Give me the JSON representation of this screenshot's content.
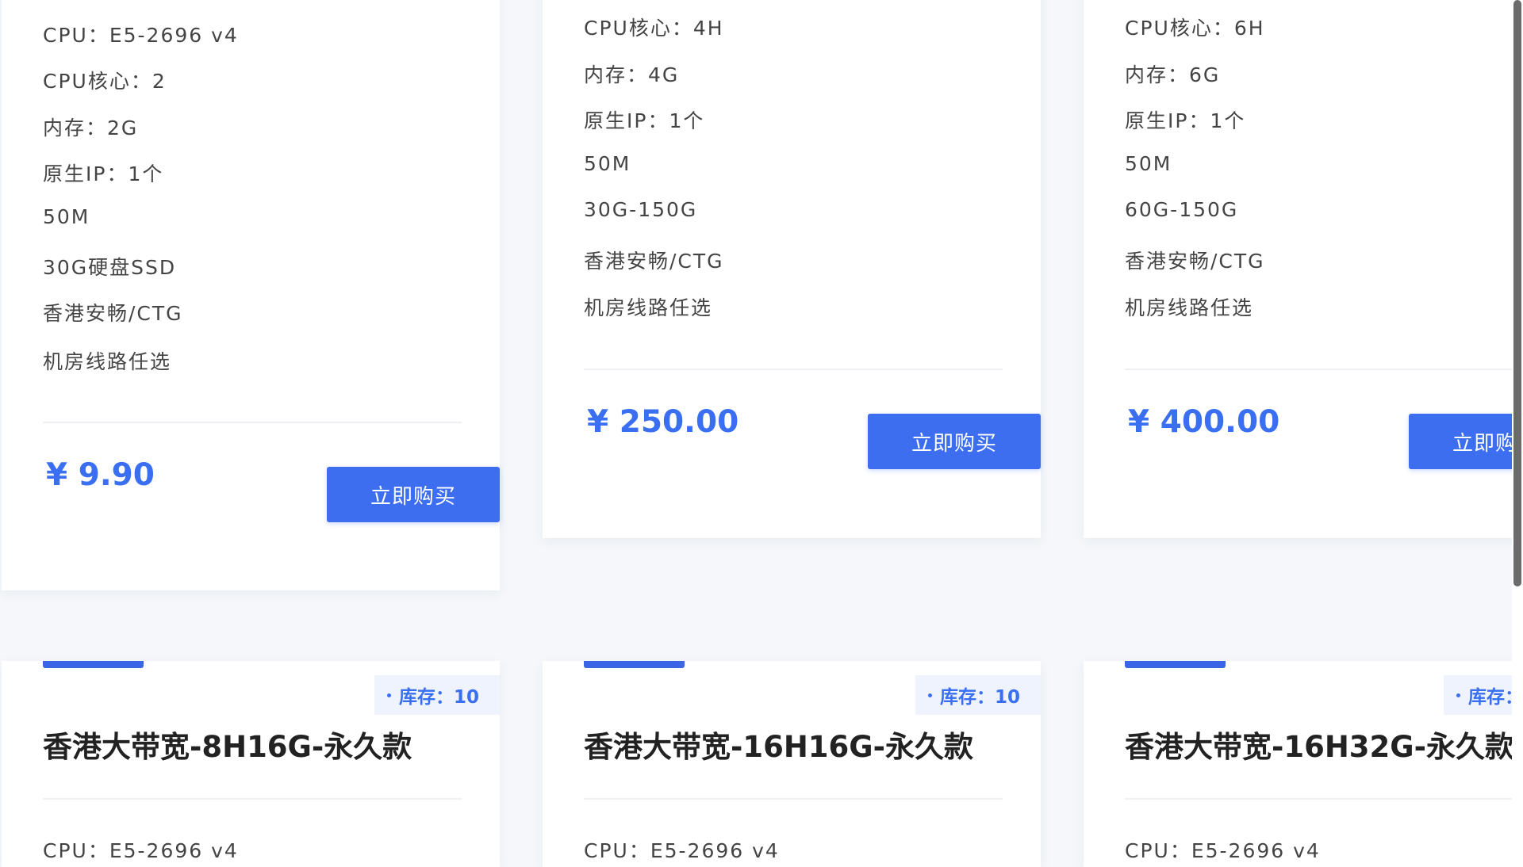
{
  "top_cards": [
    {
      "specs": [
        "CPU：E5-2696 v4",
        "CPU核心：2",
        "内存：2G",
        "原生IP：1个",
        "50M",
        "30G硬盘SSD",
        "香港安畅/CTG",
        "机房线路任选"
      ],
      "price": "¥ 9.90",
      "buy_label": "立即购买"
    },
    {
      "specs": [
        "CPU核心：4H",
        "内存：4G",
        "原生IP：1个",
        "50M",
        "30G-150G",
        "香港安畅/CTG",
        "机房线路任选"
      ],
      "price": "¥ 250.00",
      "buy_label": "立即购买"
    },
    {
      "specs": [
        "CPU核心：6H",
        "内存：6G",
        "原生IP：1个",
        "50M",
        "60G-150G",
        "香港安畅/CTG",
        "机房线路任选"
      ],
      "price": "¥ 400.00",
      "buy_label": "立即购买"
    }
  ],
  "bottom_cards": [
    {
      "stock": "库存：10",
      "title": "香港大带宽-8H16G-永久款",
      "first_spec": "CPU：E5-2696 v4"
    },
    {
      "stock": "库存：10",
      "title": "香港大带宽-16H16G-永久款",
      "first_spec": "CPU：E5-2696 v4"
    },
    {
      "stock": "库存：",
      "title": "香港大带宽-16H32G-永久款",
      "first_spec": "CPU：E5-2696 v4"
    }
  ],
  "colors": {
    "accent": "#3d6ef0",
    "price": "#3a6ff2",
    "background": "#f5f7fa"
  }
}
